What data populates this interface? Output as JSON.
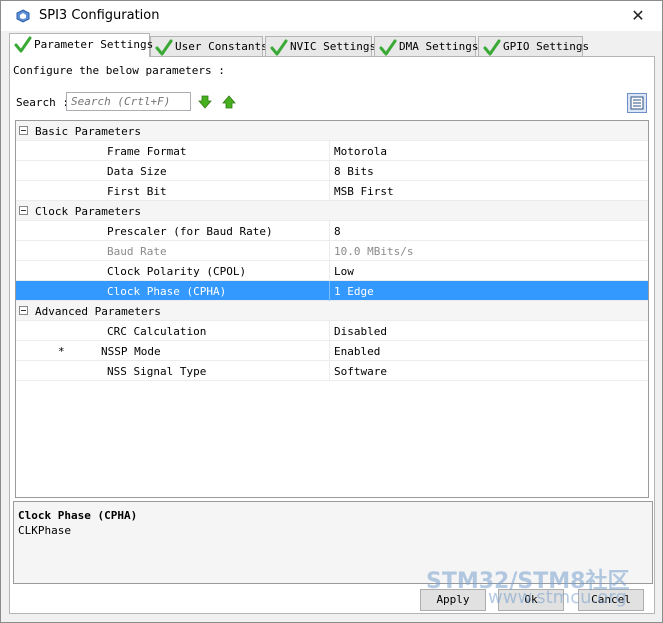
{
  "window": {
    "title": "SPI3 Configuration",
    "close_glyph": "✕"
  },
  "tabs": [
    {
      "label": "Parameter Settings",
      "active": true,
      "icon": "checkmark-icon"
    },
    {
      "label": "User Constants",
      "active": false,
      "icon": "checkmark-icon"
    },
    {
      "label": "NVIC Settings",
      "active": false,
      "icon": "checkmark-icon"
    },
    {
      "label": "DMA Settings",
      "active": false,
      "icon": "checkmark-icon"
    },
    {
      "label": "GPIO Settings",
      "active": false,
      "icon": "checkmark-icon"
    }
  ],
  "panel": {
    "heading": "Configure the below parameters :"
  },
  "search": {
    "label": "Search :",
    "placeholder": "Search (Crtl+F)"
  },
  "groups": [
    {
      "title": "Basic Parameters",
      "params": [
        {
          "name": "Frame Format",
          "value": "Motorola"
        },
        {
          "name": "Data Size",
          "value": "8 Bits"
        },
        {
          "name": "First Bit",
          "value": "MSB First"
        }
      ]
    },
    {
      "title": "Clock Parameters",
      "params": [
        {
          "name": "Prescaler (for Baud Rate)",
          "value": "8"
        },
        {
          "name": "Baud Rate",
          "value": "10.0 MBits/s"
        },
        {
          "name": "Clock Polarity (CPOL)",
          "value": "Low"
        },
        {
          "name": "Clock Phase (CPHA)",
          "value": "1 Edge"
        }
      ]
    },
    {
      "title": "Advanced Parameters",
      "params": [
        {
          "name": "CRC Calculation",
          "value": "Disabled"
        },
        {
          "name": "NSSP Mode",
          "value": "Enabled",
          "marker": "*"
        },
        {
          "name": "NSS Signal Type",
          "value": "Software"
        }
      ]
    }
  ],
  "description": {
    "title": "Clock Phase (CPHA)",
    "text": "CLKPhase"
  },
  "buttons": {
    "apply": "Apply",
    "ok": "Ok",
    "cancel": "Cancel"
  },
  "watermark": {
    "line1": "STM32/STM8社区",
    "line2": "www.stmcu.org"
  },
  "colors": {
    "selection": "#3399ff",
    "check_green": "#3aa935"
  }
}
